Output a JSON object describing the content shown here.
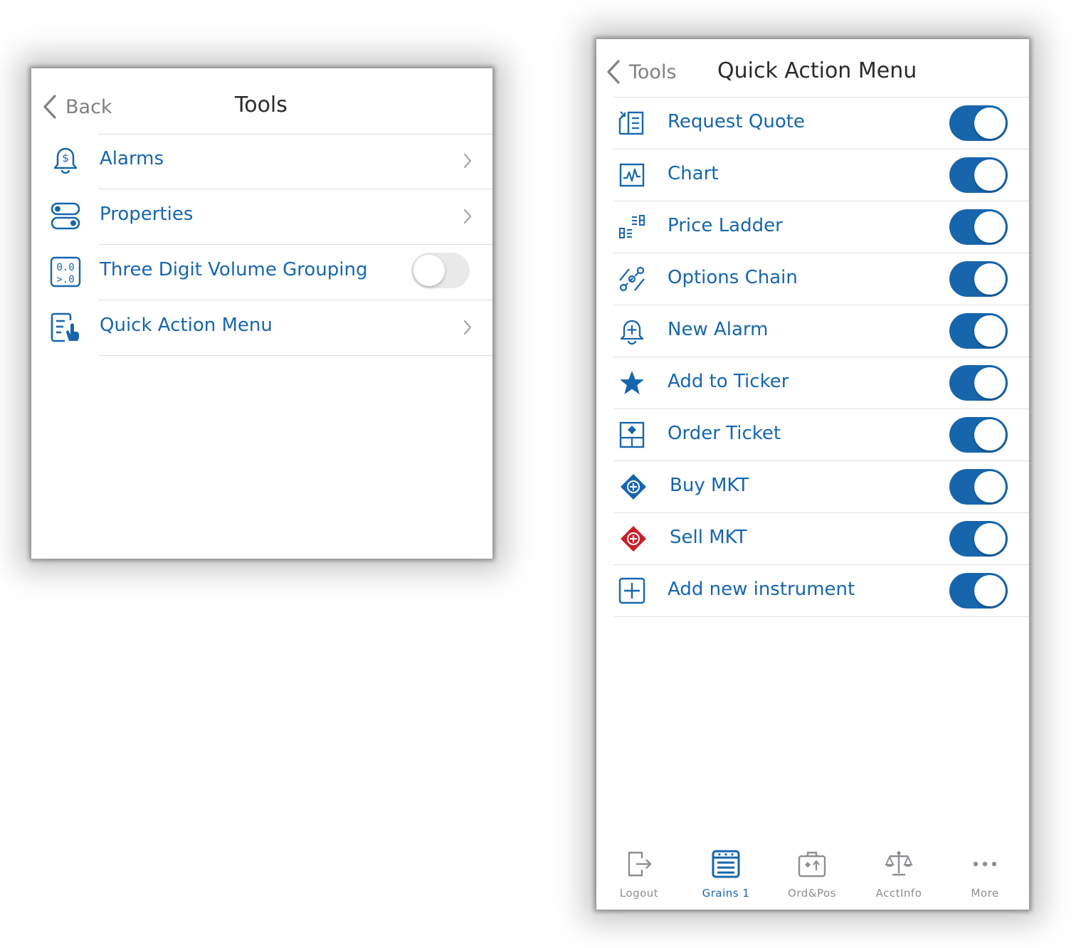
{
  "colors": {
    "accent": "#1766ad",
    "sell_red": "#c8202a",
    "inactive_gray": "#8e8e93"
  },
  "tools_screen": {
    "back_label": "Back",
    "title": "Tools",
    "items": [
      {
        "label": "Alarms",
        "icon": "dollar-bell-icon",
        "control": "chevron"
      },
      {
        "label": "Properties",
        "icon": "toggles-icon",
        "control": "chevron"
      },
      {
        "label": "Three Digit Volume Grouping",
        "icon": "digit-grouping-icon",
        "control": "toggle",
        "on": false
      },
      {
        "label": "Quick Action Menu",
        "icon": "quick-action-icon",
        "control": "chevron"
      }
    ]
  },
  "quick_action_screen": {
    "back_label": "Tools",
    "title": "Quick Action Menu",
    "items": [
      {
        "label": "Request Quote",
        "icon": "request-quote-icon",
        "on": true
      },
      {
        "label": "Chart",
        "icon": "chart-icon",
        "on": true
      },
      {
        "label": "Price Ladder",
        "icon": "price-ladder-icon",
        "on": true
      },
      {
        "label": "Options Chain",
        "icon": "options-chain-icon",
        "on": true
      },
      {
        "label": "New Alarm",
        "icon": "new-alarm-icon",
        "on": true
      },
      {
        "label": "Add to Ticker",
        "icon": "star-icon",
        "on": true
      },
      {
        "label": "Order Ticket",
        "icon": "order-ticket-icon",
        "on": true
      },
      {
        "label": "Buy MKT",
        "icon": "buy-diamond-icon",
        "on": true
      },
      {
        "label": "Sell MKT",
        "icon": "sell-diamond-icon",
        "on": true
      },
      {
        "label": "Add new instrument",
        "icon": "plus-square-icon",
        "on": true
      }
    ],
    "tabbar": [
      {
        "label": "Logout",
        "icon": "logout-icon",
        "active": false
      },
      {
        "label": "Grains 1",
        "icon": "grid-board-icon",
        "active": true
      },
      {
        "label": "Ord&Pos",
        "icon": "briefcase-icon",
        "active": false
      },
      {
        "label": "AcctInfo",
        "icon": "scales-icon",
        "active": false
      },
      {
        "label": "More",
        "icon": "more-dots-icon",
        "active": false
      }
    ]
  }
}
